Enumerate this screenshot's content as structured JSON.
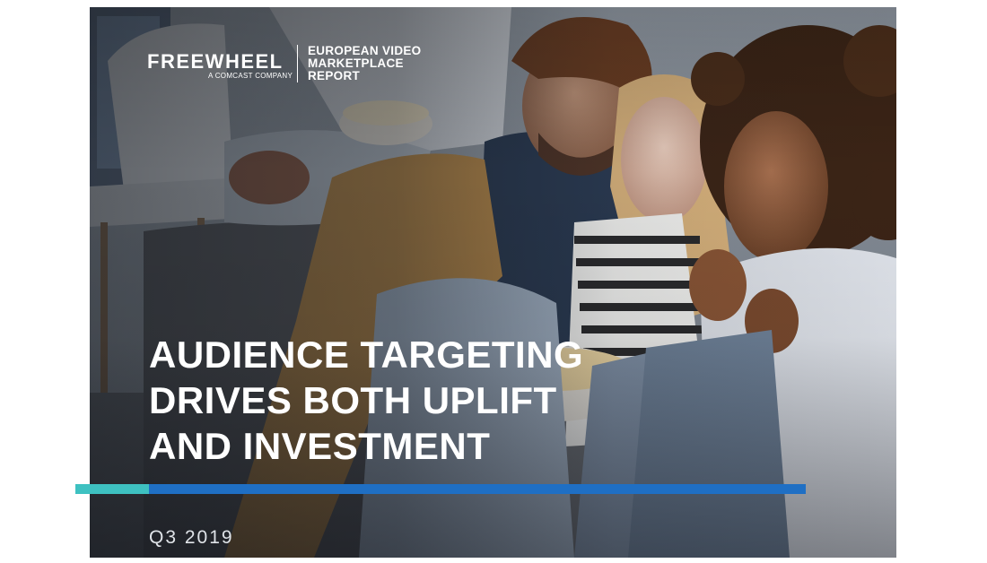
{
  "brand": {
    "logo_text": "FREEWHEEL",
    "logo_subtitle": "A COMCAST COMPANY"
  },
  "report": {
    "title_lines": [
      "EUROPEAN VIDEO",
      "MARKETPLACE",
      "REPORT"
    ]
  },
  "headline": {
    "lines": [
      "AUDIENCE TARGETING",
      "DRIVES BOTH UPLIFT",
      "AND INVESTMENT"
    ]
  },
  "period": "Q3 2019",
  "colors": {
    "accent_teal": "#3ec1c1",
    "accent_blue": "#1f6fc4",
    "text_white": "#ffffff"
  },
  "icons": {
    "photo": "friends-watching-tv-photo"
  }
}
